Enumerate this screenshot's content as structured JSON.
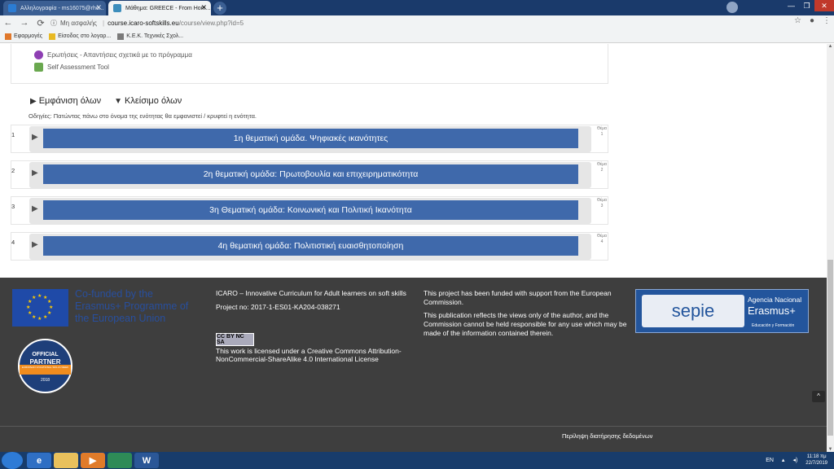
{
  "browser": {
    "tabs": [
      {
        "title": "Αλληλογραφία - ms16075@rho..."
      },
      {
        "title": "Μάθημα: GREECE - From Hom..."
      }
    ],
    "new_tab": "+",
    "nav": {
      "back": "←",
      "forward": "→",
      "reload": "C"
    },
    "address": {
      "security": "Μη ασφαλής",
      "domain": "course.icaro-softskills.eu",
      "path": "/course/view.php?id=5"
    },
    "bookmarks": [
      {
        "label": "Εφαρμογές"
      },
      {
        "label": "Είσοδος στο λογαρ..."
      },
      {
        "label": "Κ.Ε.Κ. Τεχνικές Σχολ..."
      }
    ],
    "colors": {
      "tab_strip": "#1a3a6b",
      "toolbar": "#f1f3f4"
    }
  },
  "resources": [
    {
      "label": "Ερωτήσεις - Απαντήσεις σχετικά με το πρόγραμμα",
      "icon": "forum-icon",
      "color": "#8e3fb3"
    },
    {
      "label": "Self Assessment Tool",
      "icon": "quiz-icon",
      "color": "#6aa84f"
    }
  ],
  "controls": {
    "show_all": "Εμφάνιση όλων",
    "hide_all": "Κλείσιμο όλων"
  },
  "hint": "Οδηγίες: Πατώντας πάνω στο όνομα της ενότητας θα εμφανιστεί / κρυφτεί η ενότητα.",
  "sections": [
    {
      "num": "1",
      "title": "1η θεματική ομάδα. Ψηφιακές ικανότητες",
      "side": "Θέμα 1"
    },
    {
      "num": "2",
      "title": "2η θεματική ομάδα: Πρωτοβουλία και επιχειρηματικότητα",
      "side": "Θέμα 2"
    },
    {
      "num": "3",
      "title": "3η Θεματική ομάδα: Κοινωνική και Πολιτική Ικανότητα",
      "side": "Θέμα 3"
    },
    {
      "num": "4",
      "title": "4η θεματική ομάδα: Πολιτιστική ευαισθητοποίηση",
      "side": "Θέμα 4"
    }
  ],
  "footer": {
    "eu_text": "Co-funded by the Erasmus+ Programme of the European Union",
    "partner": {
      "line1": "OFFICIAL",
      "line2": "PARTNER",
      "band": "EUROPEAN VOCATIONAL SKILLS WEEK",
      "year": "2018"
    },
    "icaro": "ICARO – Innovative Curriculum for Adult learners on soft skills",
    "project_no": "Project no: 2017-1-ES01-KA204-038271",
    "cc_badge": "CC BY NC SA",
    "license": "This work is licensed under a Creative Commons Attribution-NonCommercial-ShareAlike 4.0 International License",
    "funded": "This project has been funded with support from the European Commission.",
    "disclaimer": "This publication reflects the views only of the author, and the Commission cannot be held responsible for any use which may be made of the information contained therein.",
    "sepie": {
      "logo": "sepie",
      "agency": "Agencia Nacional",
      "erasmus": "Erasmus+",
      "edu": "Educación y Formación"
    },
    "privacy": "Περίληψη διατήρησης δεδομένων",
    "to_top": "^"
  },
  "taskbar": {
    "lang": "EN",
    "time": "11:18 πμ",
    "date": "22/7/2019",
    "apps": [
      {
        "name": "ie-icon",
        "glyph": "e",
        "color": "#2f6fc4"
      },
      {
        "name": "folder-icon",
        "glyph": "",
        "color": "#e8c15c"
      },
      {
        "name": "media-player-icon",
        "glyph": "▶",
        "color": "#e07b2a"
      },
      {
        "name": "chrome-icon",
        "glyph": "",
        "color": "#2e8b57"
      },
      {
        "name": "word-icon",
        "glyph": "W",
        "color": "#2b5797"
      }
    ]
  }
}
